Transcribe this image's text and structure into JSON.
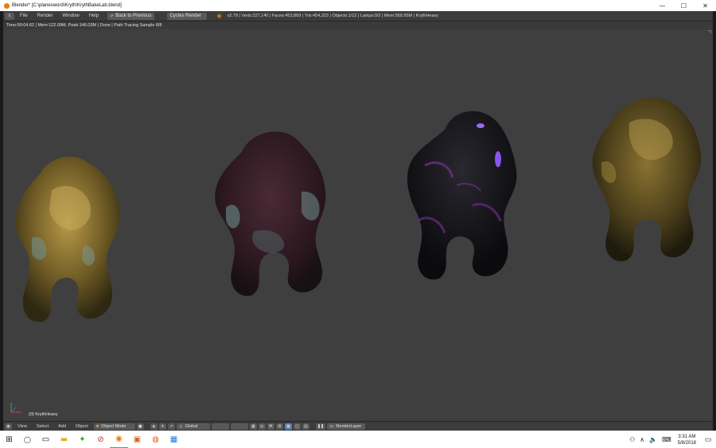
{
  "window": {
    "title": "Blender* [C:\\planesword\\Kryth\\KrythBakeLab.blend]",
    "minimize_glyph": "—",
    "maximize_glyph": "☐",
    "close_glyph": "✕"
  },
  "info_header": {
    "menus": [
      "File",
      "Render",
      "Window",
      "Help"
    ],
    "back_label": "Back to Previous",
    "render_engine": "Cycles Render",
    "stats": "v2.79 | Verts:227,140 | Faces:453,869 | Tris:454,323 | Objects:1/12 | Lamps:0/2 | Mem:569.95M | KrythHeavy"
  },
  "render": {
    "status": "Time:00:04.62 | Mem:122.09M, Peak:146.03M | Done | Path Tracing Sample 8/8",
    "object_label": "(0) KrythHeavy"
  },
  "view_header": {
    "menus": [
      "View",
      "Select",
      "Add",
      "Object"
    ],
    "mode": "Object Mode",
    "orientation": "Global",
    "render_layer": "RenderLayer"
  },
  "taskbar": {
    "time": "3:31 AM",
    "date": "5/8/2018"
  },
  "colors": {
    "viewport_bg": "#3f3f3f",
    "header_bg": "#3c3c3c",
    "gold": "#8a7331",
    "purple_glow": "#7a3fd8",
    "accent_orange": "#e87d0d"
  }
}
